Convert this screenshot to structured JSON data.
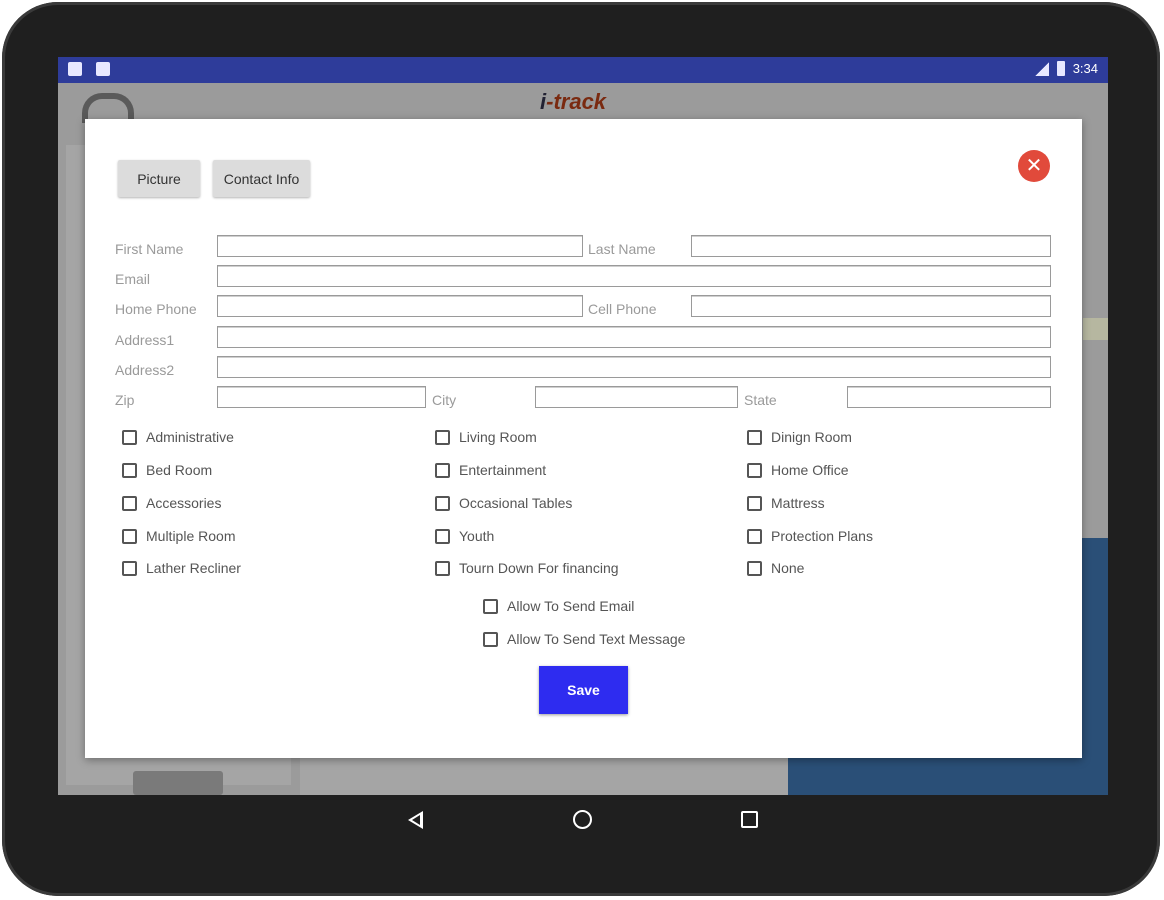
{
  "status_bar": {
    "time": "3:34"
  },
  "background_app": {
    "logo_text": "-track",
    "logo_prefix": "i"
  },
  "dialog": {
    "tabs": {
      "picture": "Picture",
      "contact_info": "Contact Info"
    },
    "close_icon": "close-icon",
    "fields": {
      "first_name": {
        "label": "First Name",
        "value": ""
      },
      "last_name": {
        "label": "Last Name",
        "value": ""
      },
      "email": {
        "label": "Email",
        "value": ""
      },
      "home_phone": {
        "label": "Home Phone",
        "value": ""
      },
      "cell_phone": {
        "label": "Cell Phone",
        "value": ""
      },
      "address1": {
        "label": "Address1",
        "value": ""
      },
      "address2": {
        "label": "Address2",
        "value": ""
      },
      "zip": {
        "label": "Zip",
        "value": ""
      },
      "city": {
        "label": "City",
        "value": ""
      },
      "state": {
        "label": "State",
        "value": ""
      }
    },
    "categories": [
      "Administrative",
      "Living Room",
      "Dinign Room",
      "Bed Room",
      "Entertainment",
      "Home Office",
      "Accessories",
      "Occasional Tables",
      "Mattress",
      "Multiple Room",
      "Youth",
      "Protection Plans",
      "Lather Recliner",
      "Tourn Down For financing",
      "None"
    ],
    "permissions": [
      "Allow To Send Email",
      "Allow To Send Text Message"
    ],
    "save_label": "Save"
  },
  "colors": {
    "status_bar": "#2e3c9a",
    "close": "#e14a3b",
    "save": "#2e2cf0"
  }
}
